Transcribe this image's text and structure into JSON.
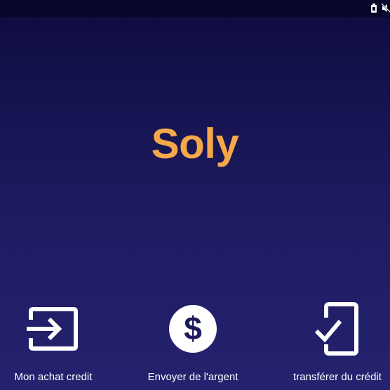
{
  "status_bar": {
    "icons": [
      "battery-icon",
      "mute-icon"
    ]
  },
  "app": {
    "title": "Soly",
    "title_color": "#f5a84a",
    "background_colors": [
      "#0d0b3e",
      "#25226f"
    ]
  },
  "actions": [
    {
      "icon": "input-icon",
      "label": "Mon achat credit"
    },
    {
      "icon": "dollar-circle-icon",
      "label": "Envoyer de l'argent"
    },
    {
      "icon": "phone-check-icon",
      "label": "transférer du crédit"
    }
  ]
}
